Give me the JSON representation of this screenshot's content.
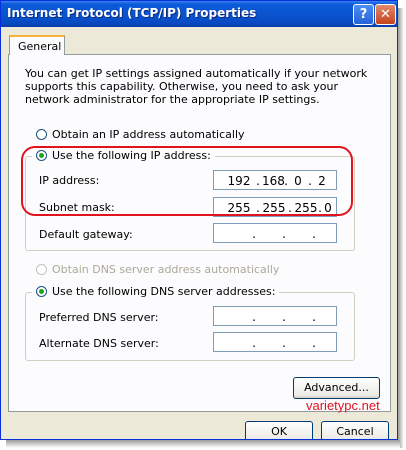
{
  "window": {
    "title": "Internet Protocol (TCP/IP) Properties",
    "help_label": "?",
    "close_label": "✕"
  },
  "tabs": [
    {
      "label": "General"
    }
  ],
  "intro_text": "You can get IP settings assigned automatically if your network supports this capability. Otherwise, you need to ask your network administrator for the appropriate IP settings.",
  "ip_section": {
    "auto_label": "Obtain an IP address automatically",
    "manual_label": "Use the following IP address:",
    "fields": [
      {
        "label": "IP address:",
        "octets": [
          "192",
          "168",
          "0",
          "2"
        ]
      },
      {
        "label": "Subnet mask:",
        "octets": [
          "255",
          "255",
          "255",
          "0"
        ]
      },
      {
        "label": "Default gateway:",
        "octets": [
          "",
          "",
          "",
          ""
        ]
      }
    ]
  },
  "dns_section": {
    "auto_label": "Obtain DNS server address automatically",
    "manual_label": "Use the following DNS server addresses:",
    "fields": [
      {
        "label": "Preferred DNS server:",
        "octets": [
          "",
          "",
          "",
          ""
        ]
      },
      {
        "label": "Alternate DNS server:",
        "octets": [
          "",
          "",
          "",
          ""
        ]
      }
    ]
  },
  "buttons": {
    "advanced": "Advanced...",
    "ok": "OK",
    "cancel": "Cancel"
  },
  "watermark": "varietypc.net",
  "colors": {
    "title_bar": "#0a54d0",
    "highlight": "#e2131d",
    "panel": "#fcfcfe",
    "dialog": "#ece9d8"
  }
}
